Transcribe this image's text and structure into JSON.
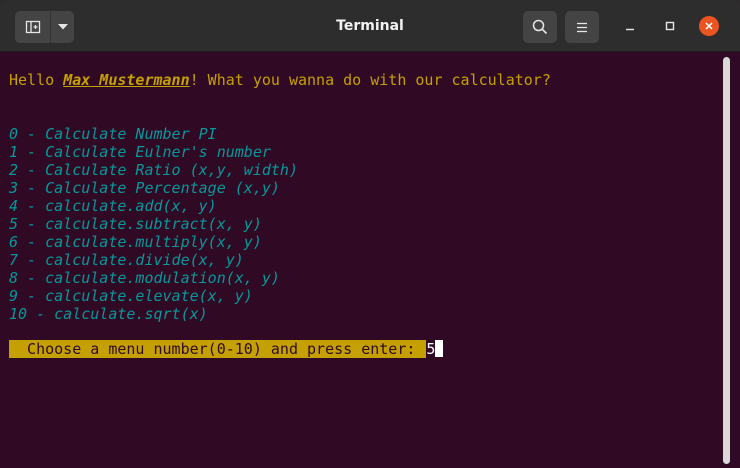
{
  "window": {
    "title": "Terminal"
  },
  "terminal": {
    "greeting_prefix": "Hello ",
    "greeting_name": "Max Mustermann",
    "greeting_suffix": "! What you wanna do with our calculator?",
    "menu_items": [
      "0 - Calculate Number PI",
      "1 - Calculate Eulner's number",
      "2 - Calculate Ratio (x,y, width)",
      "3 - Calculate Percentage (x,y)",
      "4 - calculate.add(x, y)",
      "5 - calculate.subtract(x, y)",
      "6 - calculate.multiply(x, y)",
      "7 - calculate.divide(x, y)",
      "8 - calculate.modulation(x, y)",
      "9 - calculate.elevate(x, y)",
      "10 - calculate.sqrt(x)"
    ],
    "prompt": "  Choose a menu number(0-10) and press enter: ",
    "input_value": "5"
  },
  "colors": {
    "terminal_background": "#300a24",
    "titlebar": "#2d2d2d",
    "greeting_text": "#c4a000",
    "menu_text": "#06989a",
    "prompt_background": "#c4a000",
    "close_button": "#e95420"
  },
  "icons": {
    "new_tab": "new-tab-icon",
    "tab_menu": "chevron-down-icon",
    "search": "search-icon",
    "menu": "hamburger-menu-icon",
    "minimize": "minimize-icon",
    "maximize": "maximize-icon",
    "close": "close-icon"
  }
}
